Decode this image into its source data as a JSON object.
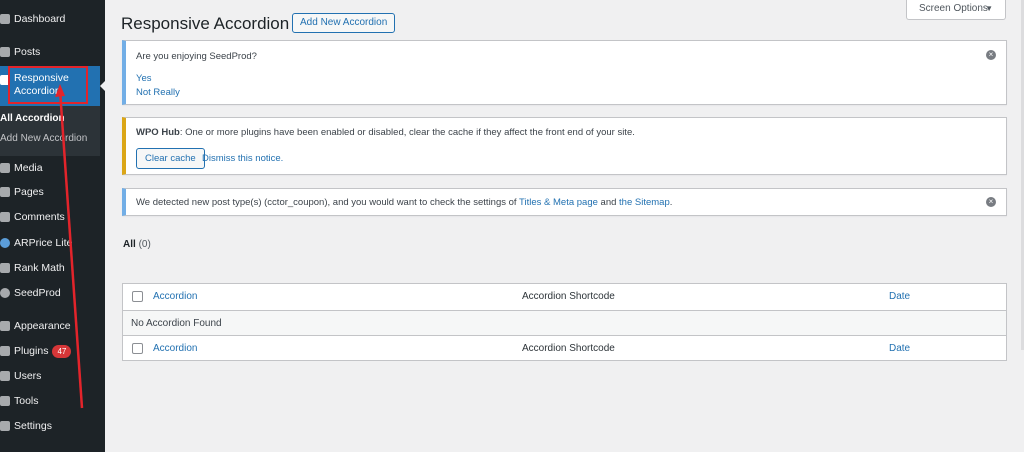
{
  "sidebar": {
    "items": [
      {
        "label": "Dashboard",
        "icon": "dashboard-icon"
      },
      {
        "label": "Posts",
        "icon": "pin-icon"
      },
      {
        "label": "Responsive Accordion",
        "icon": "list-icon"
      },
      {
        "label": "Media",
        "icon": "media-icon"
      },
      {
        "label": "Pages",
        "icon": "page-icon"
      },
      {
        "label": "Comments",
        "icon": "comment-icon"
      },
      {
        "label": "ARPrice Lite",
        "icon": "arprice-icon"
      },
      {
        "label": "Rank Math",
        "icon": "rankmath-icon"
      },
      {
        "label": "SeedProd",
        "icon": "seedprod-icon"
      },
      {
        "label": "Appearance",
        "icon": "brush-icon"
      },
      {
        "label": "Plugins",
        "icon": "plugin-icon",
        "badge": "47"
      },
      {
        "label": "Users",
        "icon": "users-icon"
      },
      {
        "label": "Tools",
        "icon": "wrench-icon"
      },
      {
        "label": "Settings",
        "icon": "settings-icon"
      }
    ],
    "submenu": [
      {
        "label": "All Accordion"
      },
      {
        "label": "Add New Accordion"
      }
    ],
    "highlight_color": "#e3242b"
  },
  "header": {
    "title": "Responsive Accordion",
    "add_new_label": "Add New Accordion",
    "screen_options_label": "Screen Options"
  },
  "notices": {
    "seedprod": {
      "question": "Are you enjoying SeedProd?",
      "yes": "Yes",
      "no": "Not Really"
    },
    "wpo": {
      "prefix": "WPO Hub",
      "message": ": One or more plugins have been enabled or disabled, clear the cache if they affect the front end of your site.",
      "clear_label": "Clear cache",
      "dismiss_label": "Dismiss this notice."
    },
    "rankmath": {
      "before": "We detected new post type(s) (cctor_coupon), and you would want to check the settings of ",
      "link1": "Titles & Meta page",
      "between": " and ",
      "link2": "the Sitemap",
      "after": "."
    }
  },
  "filters": {
    "all_label": "All",
    "all_count": "(0)"
  },
  "table": {
    "columns": {
      "title": "Accordion",
      "shortcode": "Accordion Shortcode",
      "date": "Date"
    },
    "empty_message": "No Accordion Found"
  },
  "colors": {
    "sidebar_bg": "#1d2327",
    "active_bg": "#2271b1",
    "link": "#2271b1",
    "warning": "#dba617",
    "info": "#72aee6"
  }
}
